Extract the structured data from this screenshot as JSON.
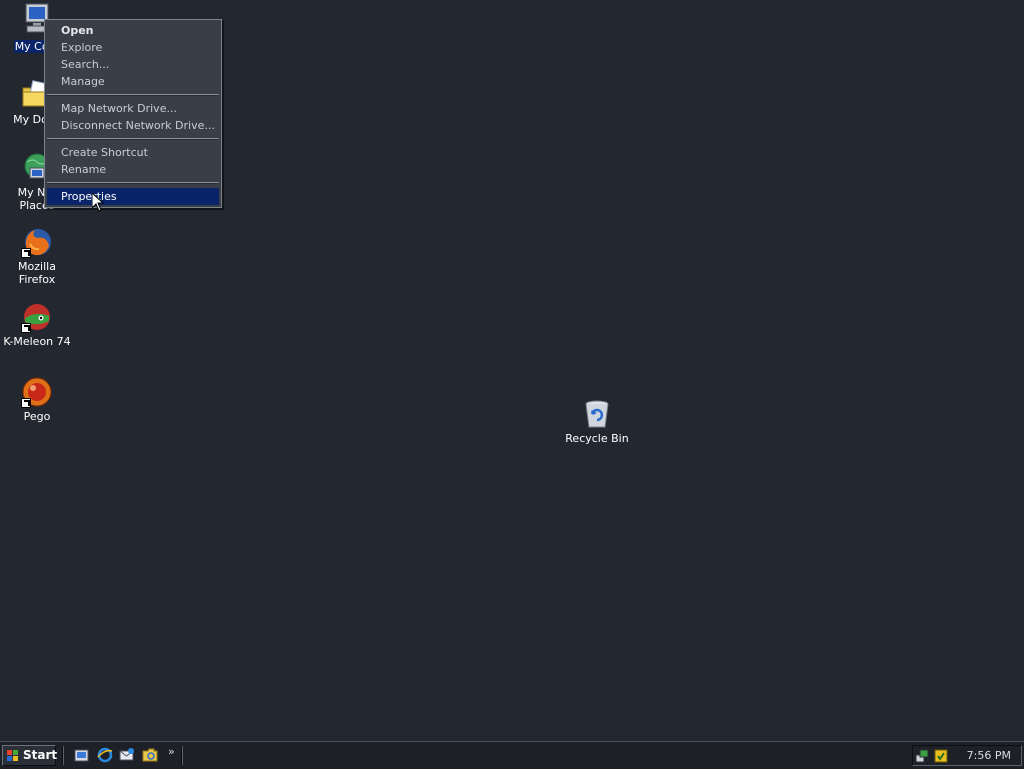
{
  "desktop": {
    "icons": [
      {
        "label": "My Computer",
        "visible_label": "My Com",
        "selected": true
      },
      {
        "label": "My Documents",
        "visible_label": "My Docu"
      },
      {
        "label_line1": "My Net",
        "label_line2": "Places"
      },
      {
        "label": "Mozilla Firefox"
      },
      {
        "label": "K-Meleon 74"
      },
      {
        "label": "Pego"
      },
      {
        "label": "Recycle Bin"
      }
    ]
  },
  "context_menu": {
    "items": [
      {
        "label": "Open",
        "bold": true
      },
      {
        "label": "Explore"
      },
      {
        "label": "Search..."
      },
      {
        "label": "Manage"
      },
      {
        "label": "Map Network Drive..."
      },
      {
        "label": "Disconnect Network Drive..."
      },
      {
        "label": "Create Shortcut"
      },
      {
        "label": "Rename"
      },
      {
        "label": "Properties",
        "highlighted": true
      }
    ]
  },
  "taskbar": {
    "start_label": "Start",
    "quicklaunch_more": "»",
    "clock": "7:56 PM"
  },
  "colors": {
    "desktop_bg": "#232830",
    "menu_bg": "#3a3f47",
    "highlight": "#0a246a",
    "taskbar_bg": "#1d2127"
  }
}
